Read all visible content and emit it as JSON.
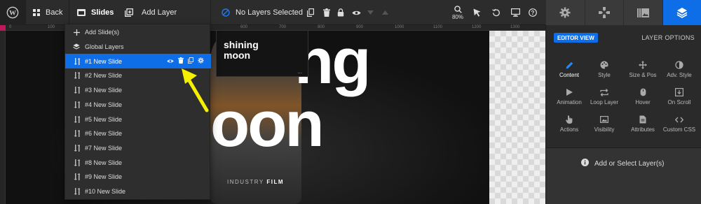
{
  "toolbar": {
    "back_label": "Back",
    "slides_label": "Slides",
    "add_layer_label": "Add Layer",
    "no_layers_label": "No Layers Selected",
    "zoom_value": "80%"
  },
  "right_tabs": [
    {
      "name": "gear-icon",
      "active": false
    },
    {
      "name": "gamepad-icon",
      "active": false
    },
    {
      "name": "media-icon",
      "active": false
    },
    {
      "name": "layers-icon",
      "active": true
    }
  ],
  "ruler": {
    "top_ticks": [
      "0",
      "100",
      "200",
      "300",
      "400",
      "500",
      "600",
      "700",
      "800",
      "900",
      "1000",
      "1100",
      "1200",
      "1300"
    ]
  },
  "slides_menu": {
    "add_slides": "Add Slide(s)",
    "global_layers": "Global Layers",
    "slides": [
      {
        "label": "#1 New Slide",
        "active": true
      },
      {
        "label": "#2 New Slide",
        "active": false
      },
      {
        "label": "#3 New Slide",
        "active": false
      },
      {
        "label": "#4 New Slide",
        "active": false
      },
      {
        "label": "#5 New Slide",
        "active": false
      },
      {
        "label": "#6 New Slide",
        "active": false
      },
      {
        "label": "#7 New Slide",
        "active": false
      },
      {
        "label": "#8 New Slide",
        "active": false
      },
      {
        "label": "#9 New Slide",
        "active": false
      },
      {
        "label": "#10 New Slide",
        "active": false
      }
    ]
  },
  "canvas": {
    "big_text_top": "ng",
    "big_text_bottom": "oon",
    "thumb_line1": "shining",
    "thumb_line2": "moon",
    "thumb_dots": "...",
    "industry_prefix": "INDUSTRY",
    "industry_suffix": "FILM"
  },
  "right_panel": {
    "editor_view": "EDITOR VIEW",
    "layer_options": "LAYER OPTIONS",
    "cells": [
      {
        "label": "Content",
        "icon": "pencil-icon",
        "active": true
      },
      {
        "label": "Style",
        "icon": "palette-icon",
        "active": false
      },
      {
        "label": "Size & Pos",
        "icon": "move-icon",
        "active": false
      },
      {
        "label": "Adv. Style",
        "icon": "contrast-icon",
        "active": false
      },
      {
        "label": "Animation",
        "icon": "play-icon",
        "active": false
      },
      {
        "label": "Loop Layer",
        "icon": "loop-icon",
        "active": false
      },
      {
        "label": "Hover",
        "icon": "mouse-icon",
        "active": false
      },
      {
        "label": "On Scroll",
        "icon": "scroll-icon",
        "active": false
      },
      {
        "label": "Actions",
        "icon": "hand-icon",
        "active": false
      },
      {
        "label": "Visibility",
        "icon": "image-icon",
        "active": false
      },
      {
        "label": "Attributes",
        "icon": "document-icon",
        "active": false
      },
      {
        "label": "Custom CSS",
        "icon": "code-icon",
        "active": false
      }
    ],
    "footer_message": "Add or Select Layer(s)"
  },
  "colors": {
    "accent": "#0d6ee8",
    "arrow": "#f4f000",
    "ruler_marker": "#c2185b"
  }
}
